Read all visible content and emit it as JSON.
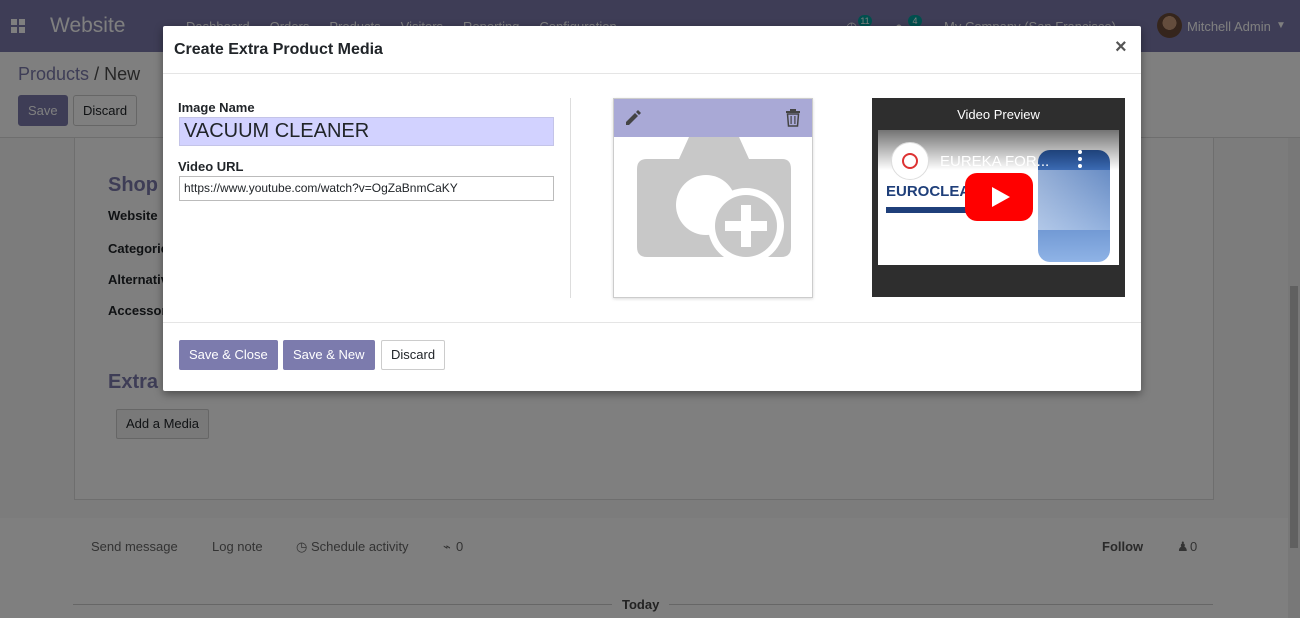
{
  "navbar": {
    "brand": "Website",
    "menu": [
      "Dashboard",
      "Orders",
      "Products",
      "Visitors",
      "Reporting",
      "Configuration"
    ],
    "activity_count": "11",
    "message_count": "4",
    "company": "My Company (San Francisco)",
    "user": "Mitchell Admin"
  },
  "control_panel": {
    "breadcrumb_parent": "Products",
    "breadcrumb_sep": "/",
    "breadcrumb_current": "New",
    "save_label": "Save",
    "discard_label": "Discard"
  },
  "form": {
    "shop_title": "Shop",
    "fields": [
      "Website",
      "Categories",
      "Alternative Products",
      "Accessory Products"
    ],
    "extra_title": "Extra Product Media",
    "add_media_label": "Add a Media"
  },
  "chatter": {
    "send_message": "Send message",
    "log_note": "Log note",
    "schedule_activity": "Schedule activity",
    "attachments": "0",
    "follow": "Follow",
    "followers": "0",
    "today": "Today"
  },
  "modal": {
    "title": "Create Extra Product Media",
    "close": "×",
    "image_name_label": "Image Name",
    "image_name_value": "VACUUM CLEANER",
    "video_url_label": "Video URL",
    "video_url_value": "https://www.youtube.com/watch?v=OgZaBnmCaKY",
    "video_preview_label": "Video Preview",
    "video_title": "EUREKA FOR...",
    "video_brand": "EUROCLEAN",
    "buttons": {
      "save_close": "Save & Close",
      "save_new": "Save & New",
      "discard": "Discard"
    }
  },
  "colors": {
    "brand": "#7c7bad",
    "input_highlight": "#d2d2ff",
    "image_toolbar": "#a9a9d6",
    "play_button": "#ff0000"
  }
}
